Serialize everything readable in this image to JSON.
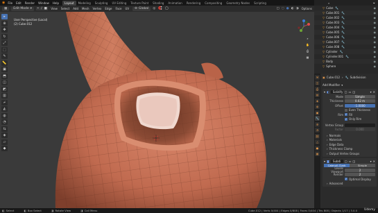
{
  "topbar": {
    "menus": [
      "File",
      "Edit",
      "Render",
      "Window",
      "Help"
    ],
    "workspaces": [
      "Layout",
      "Modeling",
      "Sculpting",
      "UV Editing",
      "Texture Paint",
      "Shading",
      "Animation",
      "Rendering",
      "Compositing",
      "Geometry Nodes",
      "Scripting"
    ],
    "active_workspace": "Layout",
    "scene_label": "Scene",
    "viewlayer_label": "ViewLayer"
  },
  "viewport_header": {
    "mode": "Edit Mode",
    "menus": [
      "View",
      "Select",
      "Add",
      "Mesh",
      "Vertex",
      "Edge",
      "Face",
      "UV"
    ],
    "transform": "Global",
    "options": "Options"
  },
  "viewport_info": {
    "line1": "User Perspective (Local)",
    "line2": "(2) Cube.012"
  },
  "outliner": {
    "rows": [
      {
        "label": "Cube"
      },
      {
        "label": "Cube.001"
      },
      {
        "label": "Cube.002"
      },
      {
        "label": "Cube.003"
      },
      {
        "label": "Cube.004"
      },
      {
        "label": "Cube.005"
      },
      {
        "label": "Cube.006"
      },
      {
        "label": "Cube.007"
      },
      {
        "label": "Cube.008"
      },
      {
        "label": "Cylinder"
      },
      {
        "label": "Cylinder.001"
      },
      {
        "label": "Body"
      },
      {
        "label": "Sphere"
      }
    ]
  },
  "properties": {
    "breadcrumb_object": "Cube.012",
    "breadcrumb_modifier": "Subdivision",
    "add_modifier": "Add Modifier",
    "modifier1": {
      "name": "Solidify",
      "mode_label": "Mode",
      "mode_value": "Simple",
      "thickness_label": "Thickness",
      "thickness_value": "0.02 m",
      "offset_label": "Offset",
      "offset_value": "-1.0000",
      "even_thickness": "Even Thickness",
      "rim_label": "Rim",
      "fill": "Fill",
      "only_rim": "Only Rim",
      "vgroup_label": "Vertex Group",
      "factor_label": "Factor",
      "factor_value": "0.000",
      "subpanels": [
        "Normals",
        "Materials",
        "Edge Data",
        "Thickness Clamp",
        "Output Vertex Groups"
      ]
    },
    "modifier2": {
      "name": "Subdi",
      "seg_catmull": "Catmull-Clark",
      "seg_simple": "Simple",
      "levels_label": "Levels Viewport",
      "levels_value": "2",
      "render_label": "Render",
      "render_value": "2",
      "optimal_display": "Optimal Display",
      "advanced": "Advanced"
    }
  },
  "statusbar": {
    "left": [
      "Select",
      "Box Select",
      "Rotate View",
      "Call Menu"
    ],
    "right": "Cube.012 | Verts 0/404 | Edges 0/808 | Faces 0/404 | Tris 808 | Objects 1/17 | 3.0.0",
    "watermark": "Udemy"
  },
  "colors": {
    "accent": "#4772b3",
    "mesh": "#c46f52"
  }
}
